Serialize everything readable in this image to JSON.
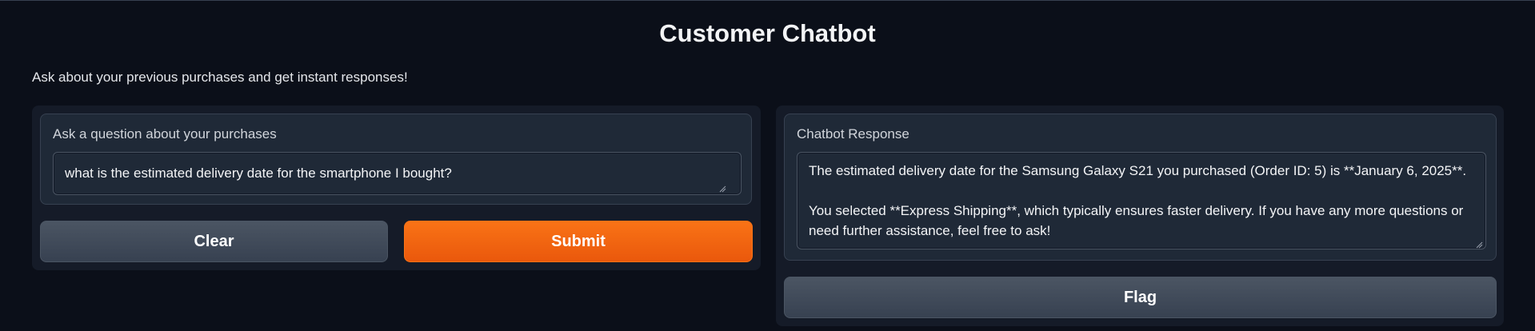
{
  "app": {
    "title": "Customer Chatbot",
    "description": "Ask about your previous purchases and get instant responses!"
  },
  "input_panel": {
    "label": "Ask a question about your purchases",
    "value": "what is the estimated delivery date for the smartphone I bought?",
    "clear_label": "Clear",
    "submit_label": "Submit"
  },
  "output_panel": {
    "label": "Chatbot Response",
    "value": "The estimated delivery date for the Samsung Galaxy S21 you purchased (Order ID: 5) is **January 6, 2025**.\n\nYou selected **Express Shipping**, which typically ensures faster delivery. If you have any more questions or need further assistance, feel free to ask!",
    "flag_label": "Flag"
  },
  "colors": {
    "background": "#0b0f19",
    "panel": "#151b28",
    "block": "#1f2937",
    "primary": "#f97316",
    "secondary": "#4b5563"
  }
}
